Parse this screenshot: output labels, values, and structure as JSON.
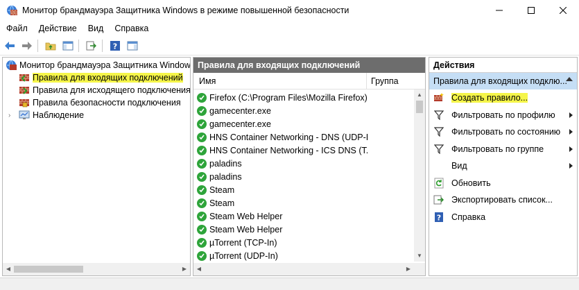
{
  "window": {
    "title": "Монитор брандмауэра Защитника Windows в режиме повышенной безопасности"
  },
  "menu": [
    "Файл",
    "Действие",
    "Вид",
    "Справка"
  ],
  "tree": {
    "root": "Монитор брандмауэра Защитника Windows",
    "items": [
      {
        "label": "Правила для входящих подключений",
        "selected": true
      },
      {
        "label": "Правила для исходящего подключения",
        "selected": false
      },
      {
        "label": "Правила безопасности подключения",
        "selected": false
      },
      {
        "label": "Наблюдение",
        "selected": false
      }
    ]
  },
  "middle": {
    "header": "Правила для входящих подключений",
    "columns": {
      "name": "Имя",
      "group": "Группа"
    },
    "rules": [
      "Firefox (C:\\Program Files\\Mozilla Firefox)",
      "gamecenter.exe",
      "gamecenter.exe",
      "HNS Container Networking - DNS (UDP-I...",
      "HNS Container Networking - ICS DNS (T...",
      "paladins",
      "paladins",
      "Steam",
      "Steam",
      "Steam Web Helper",
      "Steam Web Helper",
      "µTorrent (TCP-In)",
      "µTorrent (UDP-In)"
    ]
  },
  "actions": {
    "header": "Действия",
    "section": "Правила для входящих подклю...",
    "items": [
      {
        "label": "Создать правило...",
        "icon": "new-rule-icon",
        "highlight": true,
        "submenu": false
      },
      {
        "label": "Фильтровать по профилю",
        "icon": "filter-icon",
        "highlight": false,
        "submenu": true
      },
      {
        "label": "Фильтровать по состоянию",
        "icon": "filter-icon",
        "highlight": false,
        "submenu": true
      },
      {
        "label": "Фильтровать по группе",
        "icon": "filter-icon",
        "highlight": false,
        "submenu": true
      },
      {
        "label": "Вид",
        "icon": "",
        "highlight": false,
        "submenu": true
      },
      {
        "label": "Обновить",
        "icon": "refresh-icon",
        "highlight": false,
        "submenu": false
      },
      {
        "label": "Экспортировать список...",
        "icon": "export-icon",
        "highlight": false,
        "submenu": false
      },
      {
        "label": "Справка",
        "icon": "help-icon",
        "highlight": false,
        "submenu": false
      }
    ]
  },
  "colors": {
    "selection_highlight": "#f5f549",
    "pane_header": "#6d6d6d",
    "actions_section": "#c5def5",
    "rule_enabled": "#2ea43a"
  }
}
